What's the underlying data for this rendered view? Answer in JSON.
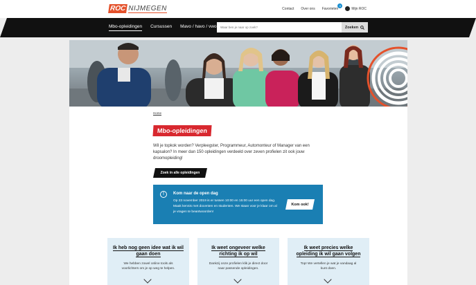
{
  "brand": {
    "logo_mark": "ROC",
    "logo_name": "NIJMEGEN",
    "accent": "#e4512b"
  },
  "top_links": {
    "contact": "Contact",
    "about": "Over ons",
    "favorites": "Favorieten",
    "favorites_count": "0",
    "account": "Mijn ROC"
  },
  "nav": {
    "items": [
      {
        "label": "Mbo-opleidingen",
        "active": true
      },
      {
        "label": "Cursussen",
        "active": false
      },
      {
        "label": "Mavo / havo / vwo",
        "active": false
      }
    ],
    "search_placeholder": "Waar ben je naar op zoek?",
    "search_button": "Zoeken"
  },
  "breadcrumb": "Home",
  "page_title": "Mbo-opleidingen",
  "intro": "Wil je topkok worden? Verpleegster, Programmeur, Automonteur of Manager van een kapsalon? In meer dan 150 opleidingen verdeeld over zeven profielen zit ook jouw droomopleiding!",
  "search_all_button": "Zoek in alle opleidingen",
  "open_day": {
    "title": "Kom naar de open dag",
    "text": "Op 23 november 2019 is er tussen 10:00 en 15:00 uur een open dag. Maak kennis met docenten en studenten. We staan voor je klaar om al je vragen te beantwoorden!",
    "button": "Kom ook!",
    "color": "#1a7fb3"
  },
  "cards": [
    {
      "title": "Ik heb nog geen idee wat ik wil gaan doen",
      "text": "We hebben zowel online tools als voorlichters om je op weg te helpen."
    },
    {
      "title": "Ik weet ongeveer welke richting ik op wil",
      "text": "Dankzij onze profielen klik je direct door naar passende opleidingen."
    },
    {
      "title": "Ik weet precies welke opleiding ik wil gaan volgen",
      "text": "Top! We vertellen je wat je vandaag al kunt doen."
    }
  ]
}
